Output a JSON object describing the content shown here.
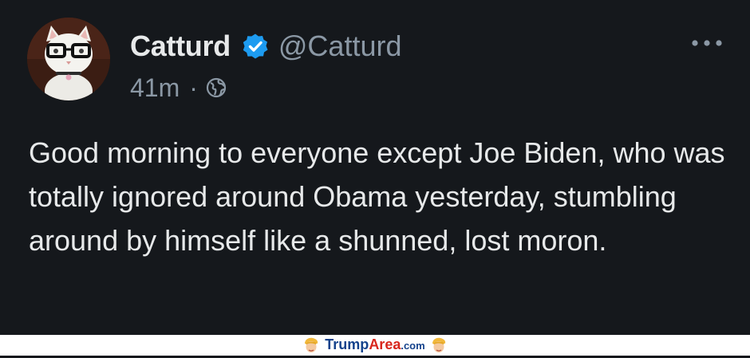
{
  "author": {
    "display_name": "Catturd",
    "handle": "@Catturd",
    "verified": true,
    "avatar_icon": "cat-with-glasses-avatar"
  },
  "meta": {
    "time": "41m",
    "separator": "·",
    "audience_icon": "globe-icon"
  },
  "menu": {
    "icon": "more-options-icon"
  },
  "tweet": {
    "text": "Good morning to everyone except Joe Biden, who was totally ignored around Obama yesterday, stumbling around by himself like a shunned, lost moron."
  },
  "watermark": {
    "text_trump": "Trump",
    "text_area": "Area",
    "text_domain": ".com"
  },
  "colors": {
    "background": "#15181c",
    "text_primary": "#e7e9ea",
    "text_secondary": "#8b98a5",
    "verified_badge": "#1d9bf0"
  }
}
